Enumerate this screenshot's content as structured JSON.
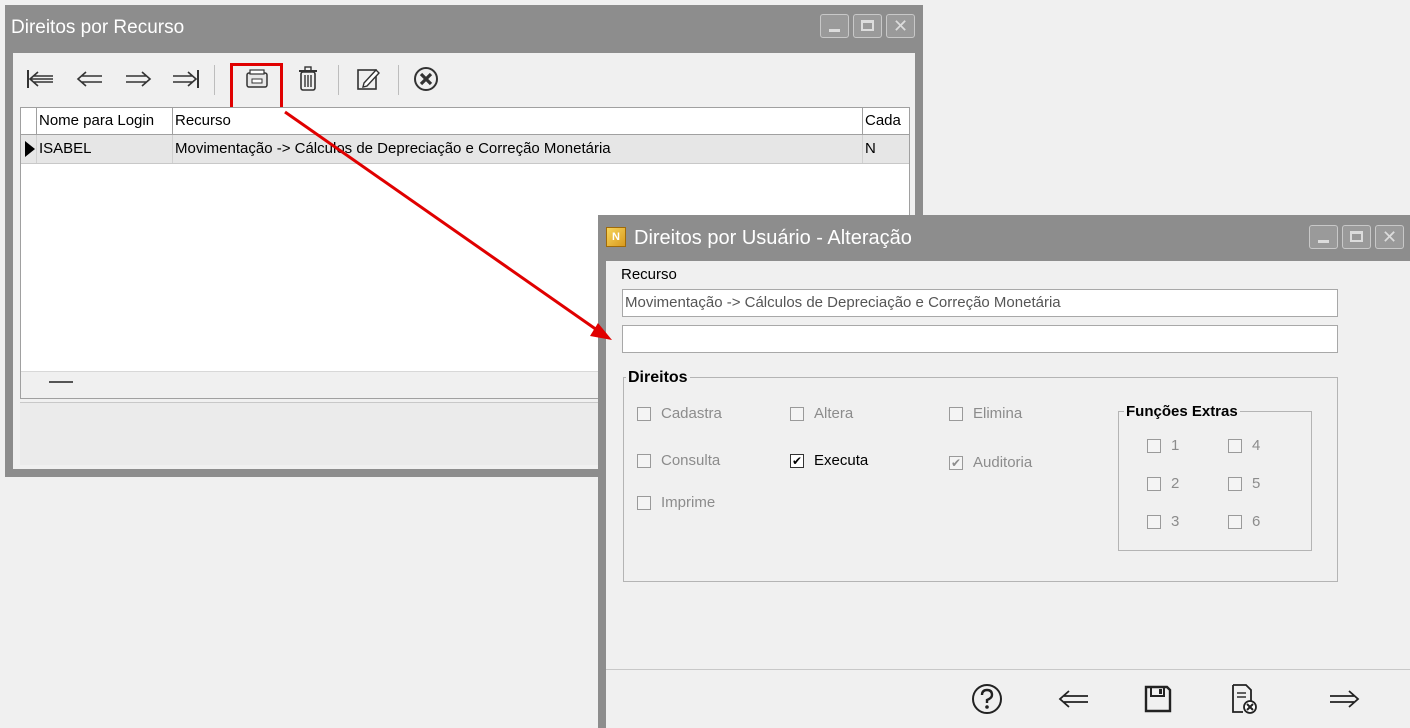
{
  "window1": {
    "title": "Direitos por Recurso",
    "toolbar": {
      "first_icon": "first-record-icon",
      "prev_icon": "previous-record-icon",
      "next_icon": "next-record-icon",
      "last_icon": "last-record-icon",
      "change_icon": "change-record-icon",
      "delete_icon": "delete-trash-icon",
      "edit_icon": "edit-pencil-icon",
      "close_icon": "close-circle-icon",
      "highlight_color": "#e00000"
    },
    "grid": {
      "columns": [
        "Nome para Login",
        "Recurso",
        "Cada"
      ],
      "rows": [
        {
          "login": "ISABEL",
          "recurso": "Movimentação -> Cálculos de Depreciação e Correção Monetária",
          "cada": "N"
        }
      ]
    }
  },
  "window2": {
    "title": "Direitos por Usuário - Alteração",
    "recurso_label": "Recurso",
    "recurso_value": "Movimentação -> Cálculos de Depreciação e Correção Monetária",
    "second_value": "",
    "direitos": {
      "title": "Direitos",
      "cadastra": "Cadastra",
      "altera": "Altera",
      "elimina": "Elimina",
      "consulta": "Consulta",
      "executa": "Executa",
      "auditoria": "Auditoria",
      "imprime": "Imprime",
      "checked": [
        "Executa",
        "Auditoria"
      ]
    },
    "funcoes_extras": {
      "title": "Funções Extras",
      "items": [
        "1",
        "2",
        "3",
        "4",
        "5",
        "6"
      ]
    },
    "bottom_buttons": [
      "help-icon",
      "back-arrow-icon",
      "save-disk-icon",
      "cancel-document-icon",
      "forward-arrow-icon"
    ]
  },
  "colors": {
    "titlebar_gray": "#8d8d8d",
    "arrow_red": "#e00000"
  }
}
